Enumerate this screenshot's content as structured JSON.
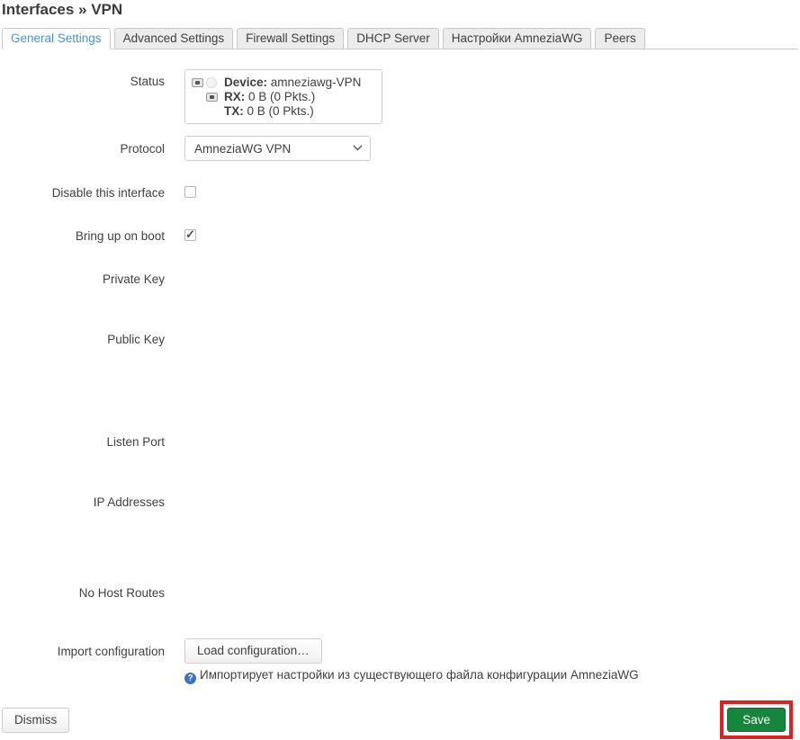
{
  "page": {
    "title": "Interfaces » VPN"
  },
  "tabs": [
    {
      "label": "General Settings",
      "active": true
    },
    {
      "label": "Advanced Settings",
      "active": false
    },
    {
      "label": "Firewall Settings",
      "active": false
    },
    {
      "label": "DHCP Server",
      "active": false
    },
    {
      "label": "Настройки AmneziaWG",
      "active": false
    },
    {
      "label": "Peers",
      "active": false
    }
  ],
  "form": {
    "status": {
      "label": "Status",
      "device_label": "Device:",
      "device_value": "amneziawg-VPN",
      "rx_label": "RX:",
      "rx_value": "0 B (0 Pkts.)",
      "tx_label": "TX:",
      "tx_value": "0 B (0 Pkts.)"
    },
    "protocol": {
      "label": "Protocol",
      "value": "AmneziaWG VPN"
    },
    "disable_interface": {
      "label": "Disable this interface",
      "checked": false
    },
    "bring_up_on_boot": {
      "label": "Bring up on boot",
      "checked": true
    },
    "private_key": {
      "label": "Private Key"
    },
    "public_key": {
      "label": "Public Key"
    },
    "listen_port": {
      "label": "Listen Port"
    },
    "ip_addresses": {
      "label": "IP Addresses"
    },
    "no_host_routes": {
      "label": "No Host Routes"
    },
    "import_config": {
      "label": "Import configuration",
      "button_label": "Load configuration…",
      "help_text": "Импортирует настройки из существующего файла конфигурации AmneziaWG"
    }
  },
  "footer": {
    "dismiss_label": "Dismiss",
    "save_label": "Save"
  },
  "colors": {
    "active_tab_blue": "#4b93d4",
    "save_green": "#15863c",
    "annotation_red": "#e02020",
    "help_icon_blue": "#3b74bd",
    "border_gray": "#cccccc"
  }
}
